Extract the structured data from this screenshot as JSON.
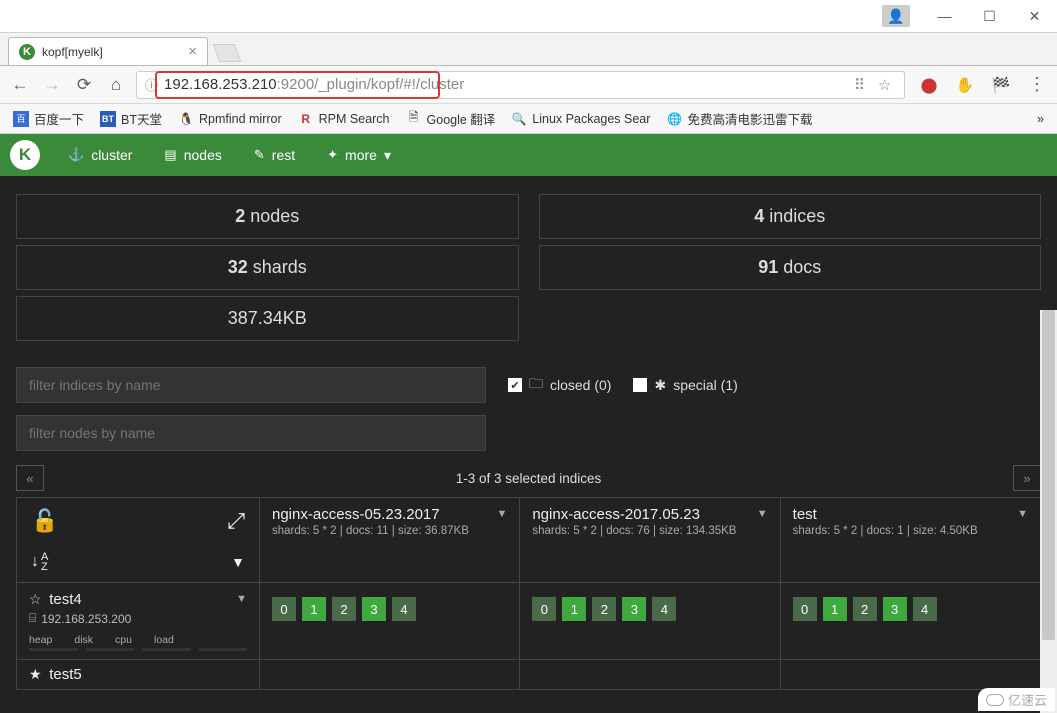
{
  "window": {
    "tab_title": "kopf[myelk]"
  },
  "omnibox": {
    "url_main": "192.168.253.210",
    "url_rest": ":9200/_plugin/kopf/#!/cluster"
  },
  "bookmarks": [
    {
      "label": "百度一下"
    },
    {
      "label": "BT天堂"
    },
    {
      "label": "Rpmfind mirror"
    },
    {
      "label": "RPM Search"
    },
    {
      "label": "Google 翻译"
    },
    {
      "label": "Linux Packages Sear"
    },
    {
      "label": "免费高清电影迅雷下载"
    }
  ],
  "nav": {
    "items": [
      {
        "label": "cluster",
        "icon": "⚙"
      },
      {
        "label": "nodes",
        "icon": "▤"
      },
      {
        "label": "rest",
        "icon": "✎"
      },
      {
        "label": "more",
        "icon": "✦",
        "caret": "▾"
      }
    ]
  },
  "stats": {
    "left": [
      {
        "value": "2",
        "label": " nodes"
      },
      {
        "value": "32",
        "label": " shards"
      },
      {
        "value": "387.34KB",
        "label": ""
      }
    ],
    "right": [
      {
        "value": "4",
        "label": " indices"
      },
      {
        "value": "91",
        "label": " docs"
      }
    ]
  },
  "filters": {
    "indices_placeholder": "filter indices by name",
    "nodes_placeholder": "filter nodes by name",
    "closed_label": "closed (0)",
    "special_label": "special (1)"
  },
  "pager": {
    "label": "1-3 of 3 selected indices"
  },
  "indices": [
    {
      "name": "nginx-access-05.23.2017",
      "meta": "shards: 5 * 2 | docs: 11 | size: 36.87KB"
    },
    {
      "name": "nginx-access-2017.05.23",
      "meta": "shards: 5 * 2 | docs: 76 | size: 134.35KB"
    },
    {
      "name": "test",
      "meta": "shards: 5 * 2 | docs: 1 | size: 4.50KB"
    }
  ],
  "nodes": [
    {
      "name": "test4",
      "ip": "192.168.253.200",
      "star": "☆",
      "labels": [
        "heap",
        "disk",
        "cpu",
        "load"
      ],
      "shards": [
        [
          {
            "n": "0"
          },
          {
            "n": "1",
            "b": 1
          },
          {
            "n": "2"
          },
          {
            "n": "3",
            "b": 1
          },
          {
            "n": "4"
          }
        ],
        [
          {
            "n": "0"
          },
          {
            "n": "1",
            "b": 1
          },
          {
            "n": "2"
          },
          {
            "n": "3",
            "b": 1
          },
          {
            "n": "4"
          }
        ],
        [
          {
            "n": "0"
          },
          {
            "n": "1",
            "b": 1
          },
          {
            "n": "2"
          },
          {
            "n": "3",
            "b": 1
          },
          {
            "n": "4"
          }
        ]
      ]
    },
    {
      "name": "test5",
      "ip": "",
      "star": "★",
      "shards": [
        [],
        [],
        []
      ]
    }
  ],
  "watermark": "亿速云"
}
